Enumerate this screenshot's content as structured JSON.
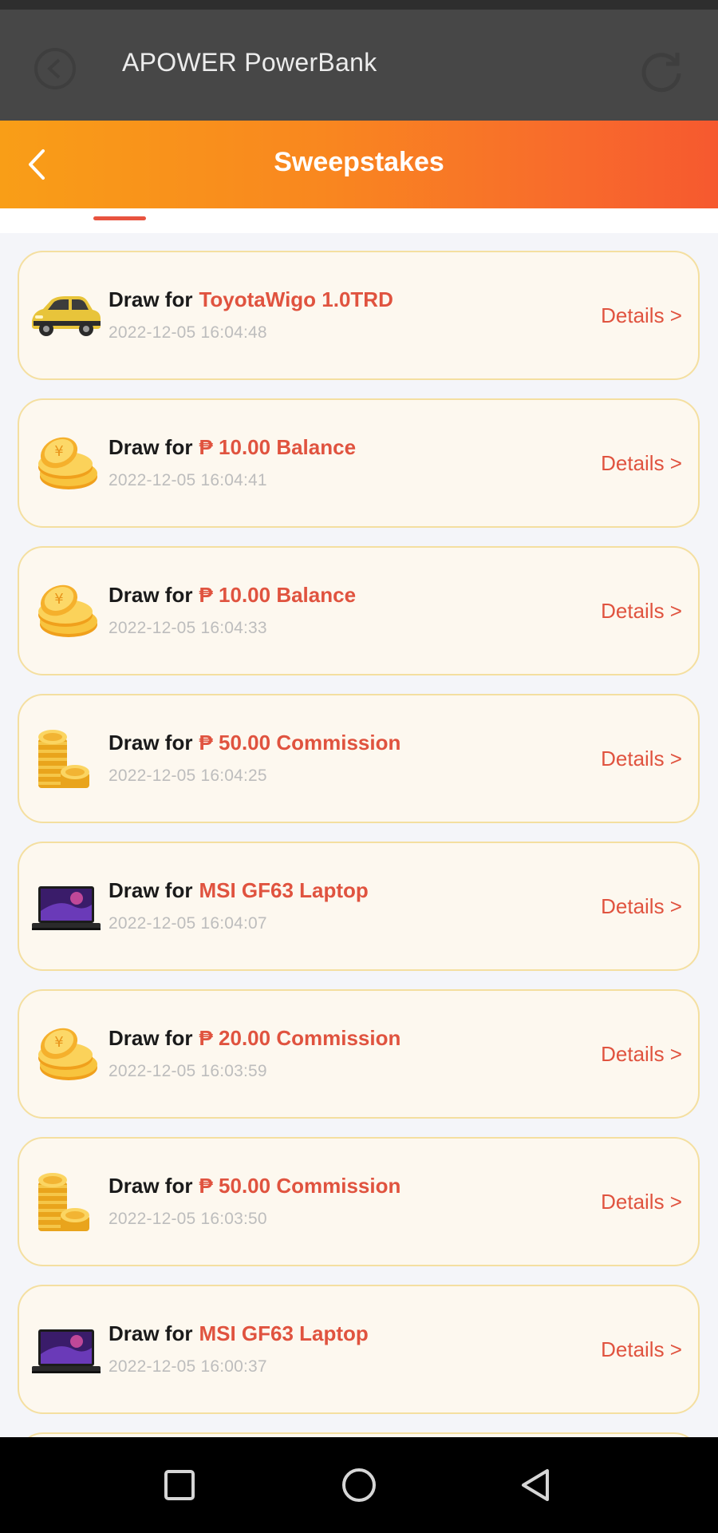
{
  "appbar": {
    "title": "APOWER PowerBank"
  },
  "header": {
    "title": "Sweepstakes"
  },
  "records": [
    {
      "draw_label": "Draw for",
      "prize": "ToyotaWigo 1.0TRD",
      "time": "2022-12-05 16:04:48",
      "details_label": "Details >",
      "icon": "car-icon"
    },
    {
      "draw_label": "Draw for",
      "prize": "₱ 10.00 Balance",
      "time": "2022-12-05 16:04:41",
      "details_label": "Details >",
      "icon": "gold-coins-icon"
    },
    {
      "draw_label": "Draw for",
      "prize": "₱ 10.00 Balance",
      "time": "2022-12-05 16:04:33",
      "details_label": "Details >",
      "icon": "gold-coins-icon"
    },
    {
      "draw_label": "Draw for",
      "prize": "₱ 50.00 Commission",
      "time": "2022-12-05 16:04:25",
      "details_label": "Details >",
      "icon": "coin-stack-icon"
    },
    {
      "draw_label": "Draw for",
      "prize": "MSI GF63 Laptop",
      "time": "2022-12-05 16:04:07",
      "details_label": "Details >",
      "icon": "laptop-icon"
    },
    {
      "draw_label": "Draw for",
      "prize": "₱ 20.00 Commission",
      "time": "2022-12-05 16:03:59",
      "details_label": "Details >",
      "icon": "gold-coins-icon"
    },
    {
      "draw_label": "Draw for",
      "prize": "₱ 50.00 Commission",
      "time": "2022-12-05 16:03:50",
      "details_label": "Details >",
      "icon": "coin-stack-icon"
    },
    {
      "draw_label": "Draw for",
      "prize": "MSI GF63 Laptop",
      "time": "2022-12-05 16:00:37",
      "details_label": "Details >",
      "icon": "laptop-icon"
    }
  ],
  "colors": {
    "header_gradient_start": "#f99e17",
    "header_gradient_end": "#f6592f",
    "prize_text": "#e0533f",
    "card_background": "#fdf8ef",
    "card_border": "#f4dfa0"
  }
}
